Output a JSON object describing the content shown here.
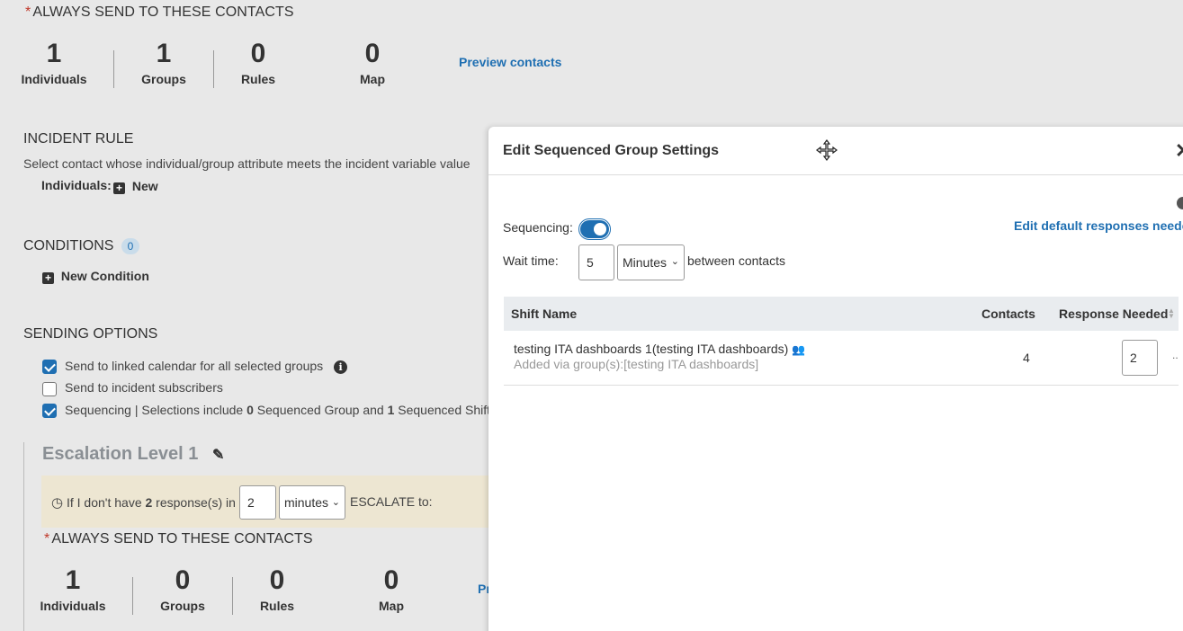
{
  "top_block": {
    "always_send_title": "ALWAYS SEND TO THESE CONTACTS",
    "counts": [
      {
        "value": "1",
        "label": "Individuals"
      },
      {
        "value": "1",
        "label": "Groups"
      },
      {
        "value": "0",
        "label": "Rules"
      },
      {
        "value": "0",
        "label": "Map"
      }
    ],
    "preview_link": "Preview contacts"
  },
  "incident_rule": {
    "title": "INCIDENT RULE",
    "description": "Select contact whose individual/group attribute meets the incident variable value",
    "individuals_label": "Individuals:",
    "new_label": "New"
  },
  "conditions": {
    "title": "CONDITIONS",
    "count": "0",
    "new_condition_label": "New Condition"
  },
  "sending_options": {
    "title": "SENDING OPTIONS",
    "linked_calendar_label": "Send to linked calendar for all selected groups",
    "incident_subscribers_label": "Send to incident subscribers",
    "sequencing_prefix": "Sequencing | Selections include ",
    "sequenced_group_count": "0",
    "sequenced_group_text": " Sequenced Group and ",
    "sequenced_shift_count": "1",
    "sequenced_shift_text": " Sequenced Shift |"
  },
  "escalation": {
    "title": "Escalation Level 1",
    "rule_prefix": "If I don't have ",
    "responses_count": "2",
    "rule_mid": " response(s) in",
    "time_value": "2",
    "time_unit": "minutes",
    "rule_suffix": "ESCALATE to:",
    "always_send_title": "ALWAYS SEND TO THESE CONTACTS",
    "counts": [
      {
        "value": "1",
        "label": "Individuals"
      },
      {
        "value": "0",
        "label": "Groups"
      },
      {
        "value": "0",
        "label": "Rules"
      },
      {
        "value": "0",
        "label": "Map"
      }
    ],
    "preview_link_partial": "Pr"
  },
  "modal": {
    "title": "Edit Sequenced Group Settings",
    "sequencing_label": "Sequencing:",
    "edit_default_link": "Edit default responses needed",
    "wait_time_label": "Wait time:",
    "wait_time_value": "5",
    "wait_time_unit": "Minutes",
    "between_label": "between contacts",
    "table": {
      "headers": {
        "shift_name": "Shift Name",
        "contacts": "Contacts",
        "response_needed": "Response Needed"
      },
      "rows": [
        {
          "shift_name": "testing ITA dashboards 1(testing ITA dashboards)",
          "added_via": "Added via group(s):[testing ITA dashboards]",
          "contacts": "4",
          "response_needed": "2"
        }
      ]
    }
  }
}
